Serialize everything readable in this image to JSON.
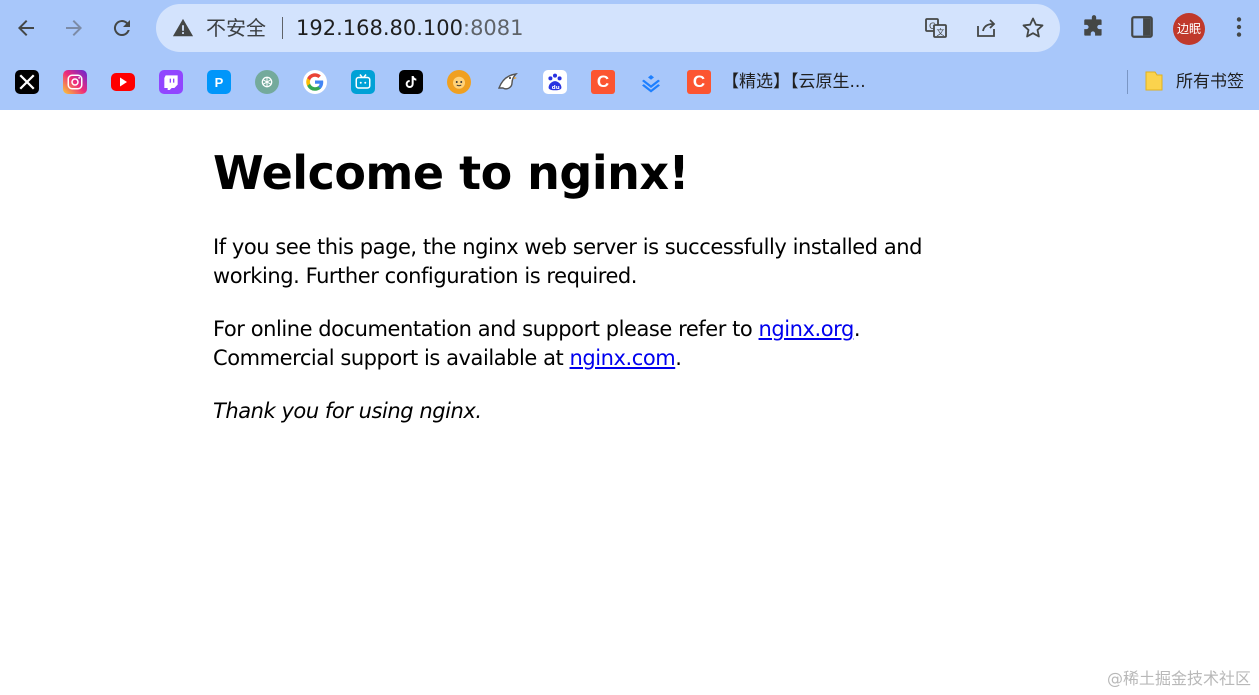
{
  "browser": {
    "security_label": "不安全",
    "url_host": "192.168.80.100",
    "url_port": ":8081",
    "profile_name": "边眠"
  },
  "bookmarks": {
    "items": [
      {
        "icon": "x-icon",
        "color": "#000000"
      },
      {
        "icon": "instagram-icon",
        "color": "#e1306c"
      },
      {
        "icon": "youtube-icon",
        "color": "#ff0000"
      },
      {
        "icon": "twitch-icon",
        "color": "#9146ff"
      },
      {
        "icon": "pixiv-icon",
        "color": "#0096fa"
      },
      {
        "icon": "chatgpt-icon",
        "color": "#74aa9c"
      },
      {
        "icon": "google-icon",
        "color": "#4285f4"
      },
      {
        "icon": "bilibili-icon",
        "color": "#00a1d6"
      },
      {
        "icon": "tiktok-icon",
        "color": "#000000"
      },
      {
        "icon": "avatar-bookmark-icon",
        "color": "#f0a020"
      },
      {
        "icon": "bird-bookmark-icon",
        "color": "#888888"
      },
      {
        "icon": "baidu-icon",
        "color": "#2932e1"
      },
      {
        "icon": "csdn-icon",
        "color": "#fc5531"
      },
      {
        "icon": "juejin-icon",
        "color": "#1e80ff"
      },
      {
        "icon": "csdn-icon",
        "color": "#fc5531"
      }
    ],
    "text_bookmark_1": "【精选】【云原生...",
    "all_bookmarks": "所有书签"
  },
  "page": {
    "title": "Welcome to nginx!",
    "para1": "If you see this page, the nginx web server is successfully installed and working. Further configuration is required.",
    "para2_prefix": "For online documentation and support please refer to ",
    "link_org": "nginx.org",
    "para2_mid": ".",
    "para2_line2": "Commercial support is available at ",
    "link_com": "nginx.com",
    "para2_end": ".",
    "para3": "Thank you for using nginx."
  },
  "watermark": "@稀土掘金技术社区"
}
